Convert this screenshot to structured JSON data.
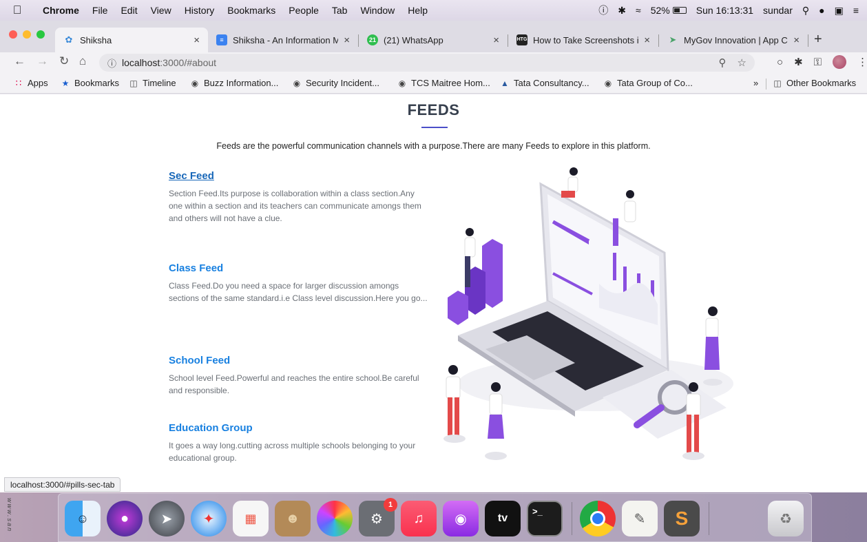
{
  "menubar": {
    "app_name": "Chrome",
    "items": [
      "File",
      "Edit",
      "View",
      "History",
      "Bookmarks",
      "People",
      "Tab",
      "Window",
      "Help"
    ],
    "battery_percent": "52%",
    "battery_level": 0.52,
    "clock": "Sun 16:13:31",
    "user": "sundar"
  },
  "tabs": [
    {
      "title": "Shiksha",
      "active": true
    },
    {
      "title": "Shiksha - An Information Ma",
      "active": false
    },
    {
      "title": "(21) WhatsApp",
      "active": false,
      "badge": "21"
    },
    {
      "title": "How to Take Screenshots in",
      "active": false,
      "favicon_text": "HTG"
    },
    {
      "title": "MyGov Innovation | App Cha",
      "active": false
    }
  ],
  "toolbar": {
    "url_host": "localhost",
    "url_rest": ":3000/#about"
  },
  "bookmarks": {
    "items": [
      "Apps",
      "Bookmarks",
      "Timeline",
      "Buzz Information...",
      "Security Incident...",
      "TCS Maitree Hom...",
      "Tata Consultancy...",
      "Tata Group of Co..."
    ],
    "overflow": "»",
    "other": "Other Bookmarks"
  },
  "page": {
    "title": "FEEDS",
    "intro": "Feeds are the powerful communication channels with a purpose.There are many Feeds to explore in this platform.",
    "feeds": [
      {
        "title": "Sec Feed",
        "text": "Section Feed.Its purpose is collaboration within a class section.Any one within a section and its teachers can communicate amongs them and others will not have a clue."
      },
      {
        "title": "Class Feed",
        "text": "Class Feed.Do you need a space for larger discussion amongs sections of the same standard.i.e Class level discussion.Here you go..."
      },
      {
        "title": "School Feed",
        "text": "School level Feed.Powerful and reaches the entire school.Be careful and responsible."
      },
      {
        "title": "Education Group",
        "text": "It goes a way long.cutting across multiple schools belonging to your educational group."
      }
    ]
  },
  "status_url": "localhost:3000/#pills-sec-tab",
  "desktop_text": "www.san",
  "dock": {
    "apps": [
      "finder-icon",
      "siri-icon",
      "launchpad-icon",
      "safari-icon",
      "app-grid-icon",
      "contacts-icon",
      "photos-icon",
      "system-preferences-icon",
      "music-icon",
      "podcasts-icon",
      "apple-tv-icon",
      "terminal-icon",
      "chrome-icon",
      "textedit-icon",
      "sublime-text-icon",
      "trash-icon"
    ],
    "prefs_badge": "1",
    "tv_label": "tv",
    "terminal_label": ">_"
  },
  "colors": {
    "accent": "#4b4ec9",
    "feed_title": "#1880e0",
    "purple": "#8a4fe0"
  }
}
